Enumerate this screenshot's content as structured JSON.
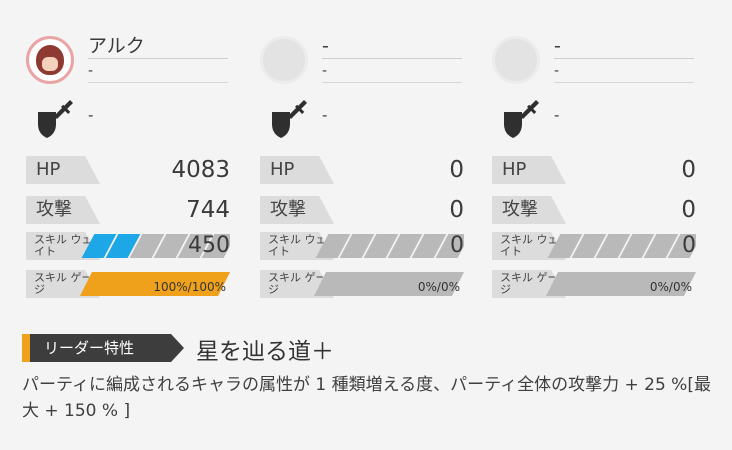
{
  "characters": [
    {
      "name": "アルク",
      "sub": "-",
      "weapon": "-",
      "hp_label": "HP",
      "hp": "4083",
      "atk_label": "攻撃",
      "atk": "744",
      "sw_label": "スキル ウェイト",
      "skill_wait": "450",
      "skill_wait_filled_segments": 2,
      "skill_wait_total_segments": 6,
      "sg_label": "スキル ゲージ",
      "skill_gauge": "100%/100%",
      "skill_gauge_fill": 1.0
    },
    {
      "name": "-",
      "sub": "-",
      "weapon": "-",
      "hp_label": "HP",
      "hp": "0",
      "atk_label": "攻撃",
      "atk": "0",
      "sw_label": "スキル ウェイト",
      "skill_wait": "0",
      "skill_wait_filled_segments": 0,
      "skill_wait_total_segments": 6,
      "sg_label": "スキル ゲージ",
      "skill_gauge": "0%/0%",
      "skill_gauge_fill": 0
    },
    {
      "name": "-",
      "sub": "-",
      "weapon": "-",
      "hp_label": "HP",
      "hp": "0",
      "atk_label": "攻撃",
      "atk": "0",
      "sw_label": "スキル ウェイト",
      "skill_wait": "0",
      "skill_wait_filled_segments": 0,
      "skill_wait_total_segments": 6,
      "sg_label": "スキル ゲージ",
      "skill_gauge": "0%/0%",
      "skill_gauge_fill": 0
    }
  ],
  "leader": {
    "tag": "リーダー特性",
    "skill_name": "星を辿る道＋",
    "description": "パーティに編成されるキャラの属性が 1 種類増える度、パーティ全体の攻撃力 + 25 %[最大 + 150 % ]"
  },
  "colors": {
    "accent_orange": "#f0a11c",
    "accent_blue": "#1ea7e6"
  },
  "icons": {
    "weapon": "sword-shield-icon",
    "avatar": "character-portrait-icon"
  }
}
